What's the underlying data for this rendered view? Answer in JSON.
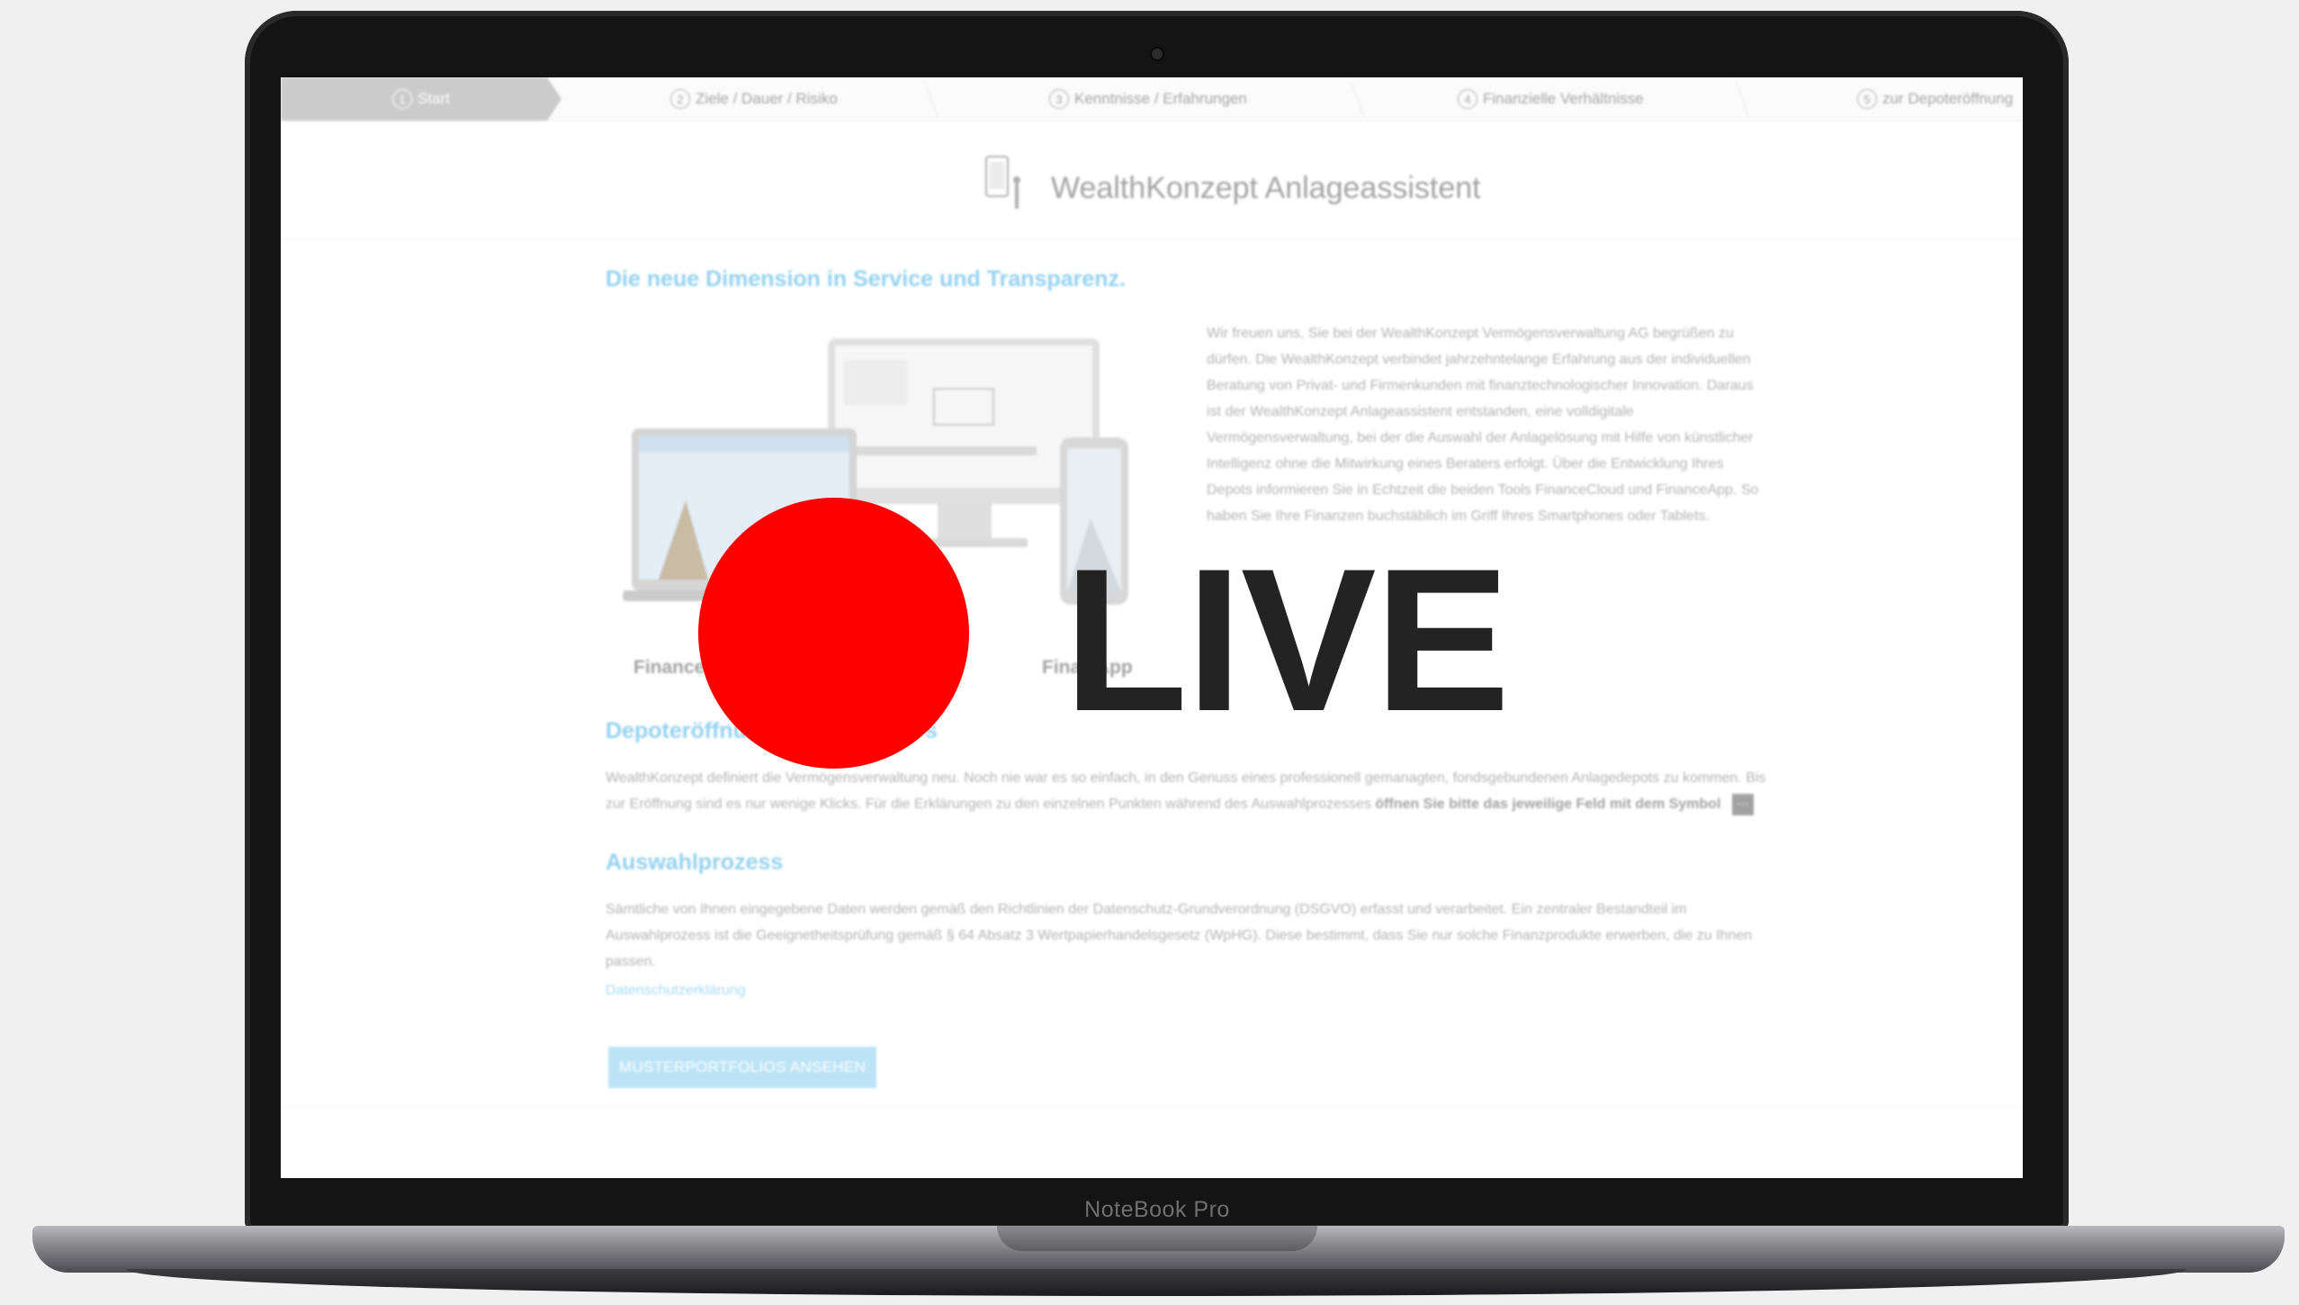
{
  "device": {
    "brand": "NoteBook Pro"
  },
  "wizard_steps": [
    {
      "num": "1",
      "label": "Start",
      "active": true
    },
    {
      "num": "2",
      "label": "Ziele / Dauer / Risiko"
    },
    {
      "num": "3",
      "label": "Kenntnisse / Erfahrungen"
    },
    {
      "num": "4",
      "label": "Finanzielle Verhältnisse"
    },
    {
      "num": "5",
      "label": "zur Depoteröffnung"
    }
  ],
  "header": {
    "title": "WealthKonzept Anlageassistent"
  },
  "intro": {
    "heading": "Die neue Dimension in Service und Transparenz.",
    "paragraph": "Wir freuen uns, Sie bei der WealthKonzept Vermögensverwaltung AG begrüßen zu dürfen. Die WealthKonzept verbindet jahrzehntelange Erfahrung aus der individuellen Beratung von Privat- und Firmenkunden mit finanztechnologischer Innovation. Daraus ist der WealthKonzept Anlageassistent entstanden, eine volldigitale Vermögensverwaltung, bei der die Auswahl der Anlagelösung mit Hilfe von künstlicher Intelligenz ohne die Mitwirkung eines Beraters erfolgt. Über die Entwicklung Ihres Depots informieren Sie in Echtzeit die beiden Tools FinanceCloud und FinanceApp. So haben Sie Ihre Finanzen buchstäblich im Griff Ihres Smartphones oder Tablets."
  },
  "devices": {
    "left_label": "Finance",
    "right_label": "Fina   App"
  },
  "depot": {
    "heading": "Depoteröffnu",
    "heading_tail": "s",
    "paragraph": "WealthKonzept definiert die Vermögensverwaltung neu. Noch nie war es so einfach, in den Genuss eines professionell gemanagten, fondsgebundenen Anlagedepots zu kommen. Bis zur Eröffnung sind es nur wenige Klicks. Für die Erklärungen zu den einzelnen Punkten während des Auswahlprozesses",
    "bold": "öffnen Sie bitte das jeweilige Feld mit dem Symbol",
    "symbol": "···"
  },
  "auswahl": {
    "heading": "Auswahlprozess",
    "paragraph": "Sämtliche von Ihnen eingegebene Daten werden gemäß den Richtlinien der Datenschutz-Grundverordnung (DSGVO) erfasst und verarbeitet. Ein zentraler Bestandteil im Auswahlprozess ist die Geeignetheitsprüfung gemäß § 64 Absatz 3 Wertpapierhandelsgesetz (WpHG). Diese bestimmt, dass Sie nur solche Finanzprodukte erwerben, die zu Ihnen passen.",
    "link": "Datenschutzerklärung"
  },
  "cta": {
    "label": "MUSTERPORTFOLIOS ANSEHEN"
  },
  "overlay": {
    "live_text": "LIVE",
    "dot_color": "#ff0000"
  }
}
